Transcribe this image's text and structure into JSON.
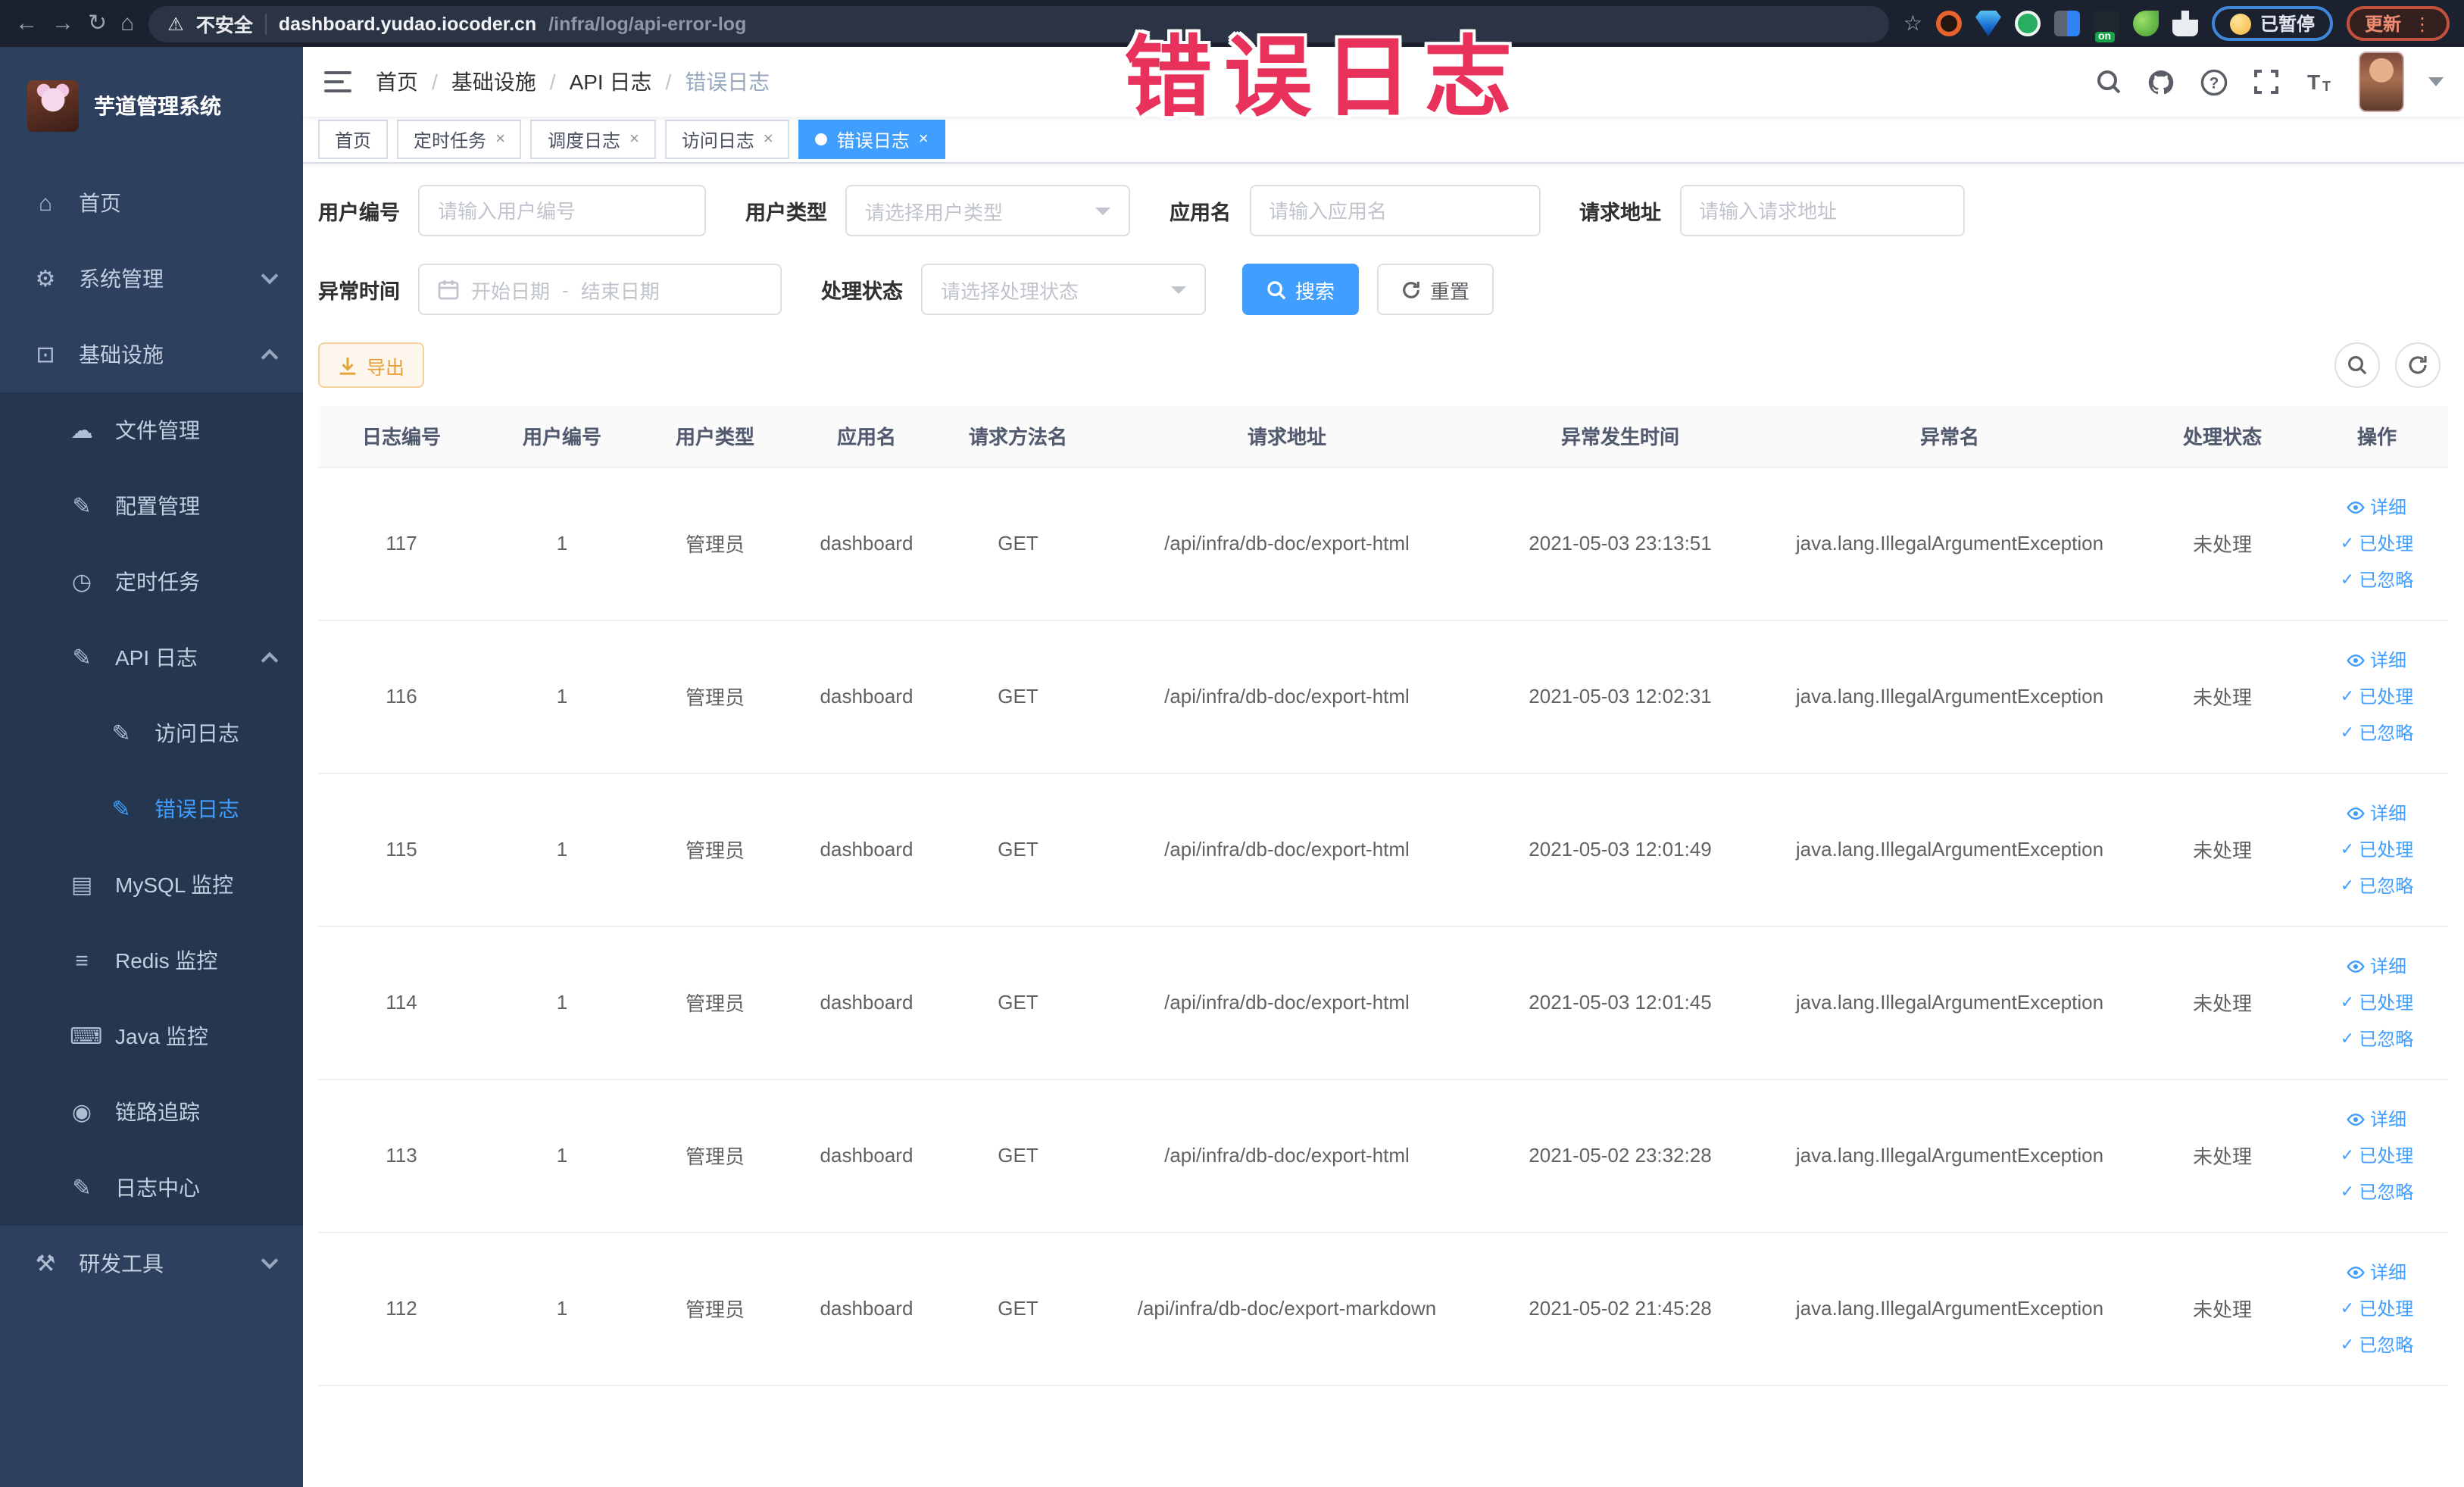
{
  "watermark": "错误日志",
  "browser": {
    "security_label": "不安全",
    "url_host": "dashboard.yudao.iocoder.cn",
    "url_path": "/infra/log/api-error-log",
    "paused_badge": "已暂停",
    "update_button": "更新"
  },
  "sidebar": {
    "logo_title": "芋道管理系统",
    "items": [
      {
        "label": "首页",
        "icon": "home-icon",
        "level": 0,
        "arrow": "",
        "active": false
      },
      {
        "label": "系统管理",
        "icon": "gear-icon",
        "level": 0,
        "arrow": "down",
        "active": false
      },
      {
        "label": "基础设施",
        "icon": "infra-icon",
        "level": 0,
        "arrow": "up",
        "active": false
      },
      {
        "label": "文件管理",
        "icon": "file-cloud-icon",
        "level": 1,
        "arrow": "",
        "active": false
      },
      {
        "label": "配置管理",
        "icon": "config-edit-icon",
        "level": 1,
        "arrow": "",
        "active": false
      },
      {
        "label": "定时任务",
        "icon": "timer-icon",
        "level": 1,
        "arrow": "",
        "active": false
      },
      {
        "label": "API 日志",
        "icon": "api-log-icon",
        "level": 1,
        "arrow": "up",
        "active": false
      },
      {
        "label": "访问日志",
        "icon": "access-log-icon",
        "level": 2,
        "arrow": "",
        "active": false
      },
      {
        "label": "错误日志",
        "icon": "error-log-icon",
        "level": 2,
        "arrow": "",
        "active": true
      },
      {
        "label": "MySQL 监控",
        "icon": "mysql-monitor-icon",
        "level": 1,
        "arrow": "",
        "active": false
      },
      {
        "label": "Redis 监控",
        "icon": "redis-monitor-icon",
        "level": 1,
        "arrow": "",
        "active": false
      },
      {
        "label": "Java 监控",
        "icon": "java-monitor-icon",
        "level": 1,
        "arrow": "",
        "active": false
      },
      {
        "label": "链路追踪",
        "icon": "trace-eye-icon",
        "level": 1,
        "arrow": "",
        "active": false
      },
      {
        "label": "日志中心",
        "icon": "log-center-icon",
        "level": 1,
        "arrow": "",
        "active": false
      },
      {
        "label": "研发工具",
        "icon": "devtools-icon",
        "level": 0,
        "arrow": "down",
        "active": false
      }
    ]
  },
  "header": {
    "breadcrumb": [
      "首页",
      "基础设施",
      "API 日志",
      "错误日志"
    ]
  },
  "tabs": [
    {
      "label": "首页",
      "closable": false,
      "active": false
    },
    {
      "label": "定时任务",
      "closable": true,
      "active": false
    },
    {
      "label": "调度日志",
      "closable": true,
      "active": false
    },
    {
      "label": "访问日志",
      "closable": true,
      "active": false
    },
    {
      "label": "错误日志",
      "closable": true,
      "active": true
    }
  ],
  "filters": {
    "user_id": {
      "label": "用户编号",
      "placeholder": "请输入用户编号",
      "value": ""
    },
    "user_type": {
      "label": "用户类型",
      "placeholder": "请选择用户类型"
    },
    "app_name": {
      "label": "应用名",
      "placeholder": "请输入应用名",
      "value": ""
    },
    "request_url": {
      "label": "请求地址",
      "placeholder": "请输入请求地址",
      "value": ""
    },
    "exception_time": {
      "label": "异常时间",
      "start_placeholder": "开始日期",
      "separator": "-",
      "end_placeholder": "结束日期"
    },
    "process_status": {
      "label": "处理状态",
      "placeholder": "请选择处理状态"
    },
    "search_label": "搜索",
    "reset_label": "重置"
  },
  "toolbar": {
    "export_label": "导出"
  },
  "table": {
    "headers": [
      "日志编号",
      "用户编号",
      "用户类型",
      "应用名",
      "请求方法名",
      "请求地址",
      "异常发生时间",
      "异常名",
      "处理状态",
      "操作"
    ],
    "row_actions": [
      "详细",
      "已处理",
      "已忽略"
    ],
    "rows": [
      {
        "id": "117",
        "user_id": "1",
        "user_type": "管理员",
        "app": "dashboard",
        "method": "GET",
        "url": "/api/infra/db-doc/export-html",
        "time": "2021-05-03 23:13:51",
        "exception": "java.lang.IllegalArgumentException",
        "status": "未处理"
      },
      {
        "id": "116",
        "user_id": "1",
        "user_type": "管理员",
        "app": "dashboard",
        "method": "GET",
        "url": "/api/infra/db-doc/export-html",
        "time": "2021-05-03 12:02:31",
        "exception": "java.lang.IllegalArgumentException",
        "status": "未处理"
      },
      {
        "id": "115",
        "user_id": "1",
        "user_type": "管理员",
        "app": "dashboard",
        "method": "GET",
        "url": "/api/infra/db-doc/export-html",
        "time": "2021-05-03 12:01:49",
        "exception": "java.lang.IllegalArgumentException",
        "status": "未处理"
      },
      {
        "id": "114",
        "user_id": "1",
        "user_type": "管理员",
        "app": "dashboard",
        "method": "GET",
        "url": "/api/infra/db-doc/export-html",
        "time": "2021-05-03 12:01:45",
        "exception": "java.lang.IllegalArgumentException",
        "status": "未处理"
      },
      {
        "id": "113",
        "user_id": "1",
        "user_type": "管理员",
        "app": "dashboard",
        "method": "GET",
        "url": "/api/infra/db-doc/export-html",
        "time": "2021-05-02 23:32:28",
        "exception": "java.lang.IllegalArgumentException",
        "status": "未处理"
      },
      {
        "id": "112",
        "user_id": "1",
        "user_type": "管理员",
        "app": "dashboard",
        "method": "GET",
        "url": "/api/infra/db-doc/export-markdown",
        "time": "2021-05-02 21:45:28",
        "exception": "java.lang.IllegalArgumentException",
        "status": "未处理"
      }
    ]
  }
}
